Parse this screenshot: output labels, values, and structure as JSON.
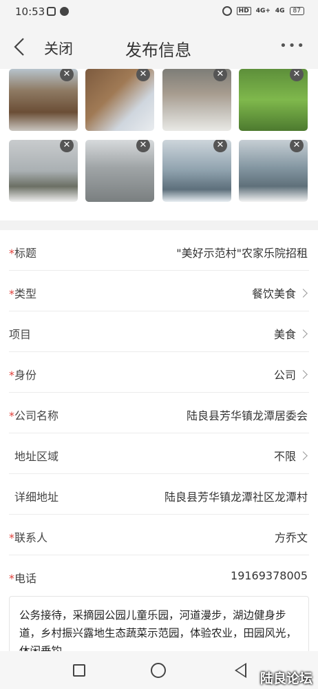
{
  "status_bar": {
    "time": "10:53",
    "hd_label": "HD",
    "signal1": "4G+",
    "signal2": "4G",
    "battery": "87"
  },
  "nav": {
    "close_label": "关闭",
    "title": "发布信息",
    "more_label": "•••"
  },
  "form": {
    "rows": [
      {
        "label": "标题",
        "required": true,
        "value": "\"美好示范村\"农家乐院招租"
      },
      {
        "label": "类型",
        "required": true,
        "value": "餐饮美食"
      },
      {
        "label": "项目",
        "required": false,
        "value": "美食"
      },
      {
        "label": "身份",
        "required": true,
        "value": "公司"
      },
      {
        "label": "公司名称",
        "required": true,
        "value": "陆良县芳华镇龙潭居委会"
      },
      {
        "label": "地址区域",
        "required": false,
        "value": "不限"
      },
      {
        "label": "详细地址",
        "required": false,
        "value": "陆良县芳华镇龙潭社区龙潭村"
      },
      {
        "label": "联系人",
        "required": true,
        "value": "方乔文"
      },
      {
        "label": "电话",
        "required": true,
        "value": "19169378005"
      }
    ],
    "required_mark": "*",
    "description": "公务接待，采摘园公园儿童乐园，河道漫步，湖边健身步道，乡村振兴露地生态蔬菜示范园，体验农业，田园风光，休闲垂钓"
  },
  "photos": {
    "delete_glyph": "✕"
  },
  "watermark": "陆良论坛"
}
